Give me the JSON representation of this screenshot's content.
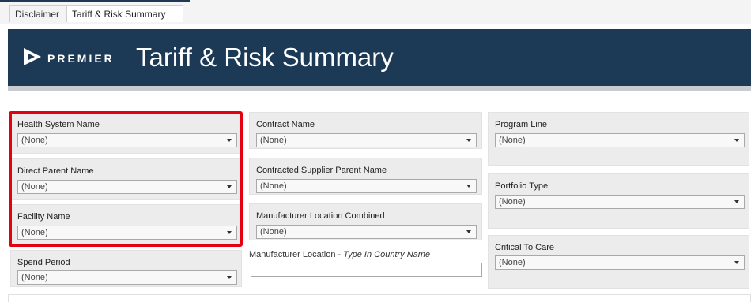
{
  "tabs": [
    {
      "label": "Disclaimer"
    },
    {
      "label": "Tariff & Risk Summary"
    }
  ],
  "header": {
    "brand": "PREMIER",
    "title": "Tariff & Risk Summary"
  },
  "colors": {
    "header_bg": "#1c3a56",
    "highlight": "#e4000f",
    "panel_bg": "#ececec"
  },
  "filters": {
    "health_system_name": {
      "label": "Health System Name",
      "value": "(None)"
    },
    "direct_parent_name": {
      "label": "Direct Parent Name",
      "value": "(None)"
    },
    "facility_name": {
      "label": "Facility Name",
      "value": "(None)"
    },
    "spend_period": {
      "label": "Spend Period",
      "value": "(None)"
    },
    "contract_name": {
      "label": "Contract Name",
      "value": "(None)"
    },
    "contracted_supplier_parent_name": {
      "label": "Contracted Supplier Parent Name",
      "value": "(None)"
    },
    "manufacturer_location_combined": {
      "label": "Manufacturer Location Combined",
      "value": "(None)"
    },
    "manufacturer_location": {
      "label": "Manufacturer Location",
      "hint": "Type In Country Name",
      "value": ""
    },
    "program_line": {
      "label": "Program Line",
      "value": "(None)"
    },
    "portfolio_type": {
      "label": "Portfolio Type",
      "value": "(None)"
    },
    "critical_to_care": {
      "label": "Critical To Care",
      "value": "(None)"
    }
  }
}
